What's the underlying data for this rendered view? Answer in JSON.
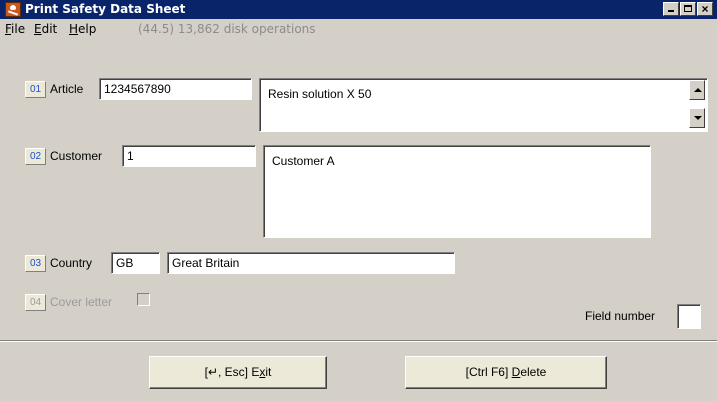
{
  "window": {
    "title": "Print Safety Data Sheet",
    "icon": "hazard-skull-icon",
    "controls": {
      "minimize": "minimize-icon",
      "maximize": "maximize-icon",
      "close": "×"
    }
  },
  "menu": {
    "file": "File",
    "edit": "Edit",
    "help": "Help",
    "status": "(44.5) 13,862 disk operations"
  },
  "fields": {
    "article": {
      "number": "01",
      "label": "Article",
      "value": "1234567890",
      "description": "Resin solution X 50"
    },
    "customer": {
      "number": "02",
      "label": "Customer",
      "value": "1",
      "description": "Customer A"
    },
    "country": {
      "number": "03",
      "label": "Country",
      "code": "GB",
      "name": "Great Britain"
    },
    "cover_letter": {
      "number": "04",
      "label": "Cover letter",
      "checked": false
    },
    "field_number": {
      "label": "Field number",
      "value": ""
    }
  },
  "buttons": {
    "exit": {
      "prefix": "[↵, Esc] E",
      "underline": "x",
      "suffix": "it"
    },
    "delete": {
      "prefix": "[Ctrl F6] ",
      "underline": "D",
      "suffix": "elete"
    }
  },
  "colors": {
    "titlebar": "#0a246a",
    "window_bg": "#d4d0c8",
    "number_badge_text": "#1e50c8",
    "disabled_text": "#9a9a9a"
  }
}
